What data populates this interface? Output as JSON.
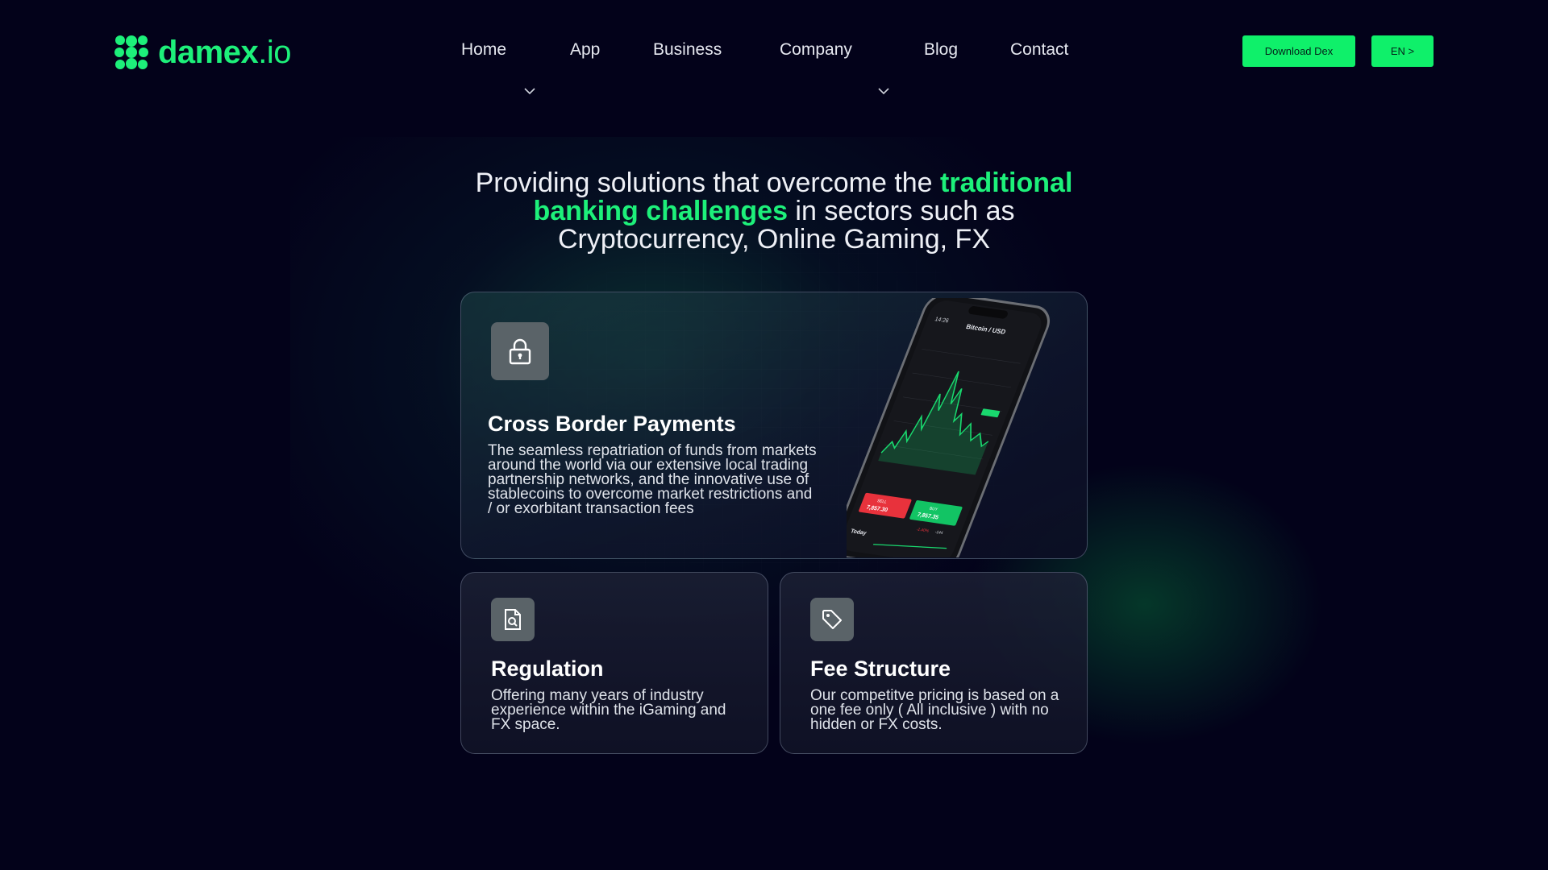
{
  "brand": {
    "name_bold": "damex",
    "name_light": ".io",
    "accent": "#1df07a"
  },
  "nav": {
    "items": [
      {
        "label": "Home",
        "has_dropdown": true
      },
      {
        "label": "App",
        "has_dropdown": false
      },
      {
        "label": "Business",
        "has_dropdown": false
      },
      {
        "label": "Company",
        "has_dropdown": true
      },
      {
        "label": "Blog",
        "has_dropdown": false
      },
      {
        "label": "Contact",
        "has_dropdown": false
      }
    ],
    "download_label": "Download Dex",
    "language_label": "EN >"
  },
  "hero": {
    "part1": "Providing solutions that overcome the ",
    "highlight": "traditional banking challenges",
    "part2": " in sectors such as Cryptocurrency, Online Gaming, FX"
  },
  "cards": [
    {
      "icon": "lock-icon",
      "title": "Cross Border Payments",
      "text": "The seamless repatriation of funds from markets around the world via our extensive local trading partnership networks, and the innovative use of stablecoins to overcome market restrictions and / or exorbitant transaction fees"
    },
    {
      "icon": "document-search-icon",
      "title": "Regulation",
      "text": "Offering many years of industry experience within the iGaming and FX space."
    },
    {
      "icon": "price-tag-icon",
      "title": "Fee Structure",
      "text": "Our competitve pricing is based on a one fee only ( All inclusive ) with no hidden or FX costs."
    }
  ],
  "phone": {
    "time": "14:26",
    "pair": "Bitcoin / USD",
    "sell_label": "SELL",
    "sell_price": "7,857.30",
    "buy_label": "BUY",
    "buy_price": "7,857.35",
    "change": "-1.40%",
    "change_abs": "-144",
    "footer": "Today"
  },
  "colors": {
    "background": "#03021a",
    "button": "#0ff06a",
    "sell": "#e8323c",
    "buy": "#12c464"
  }
}
